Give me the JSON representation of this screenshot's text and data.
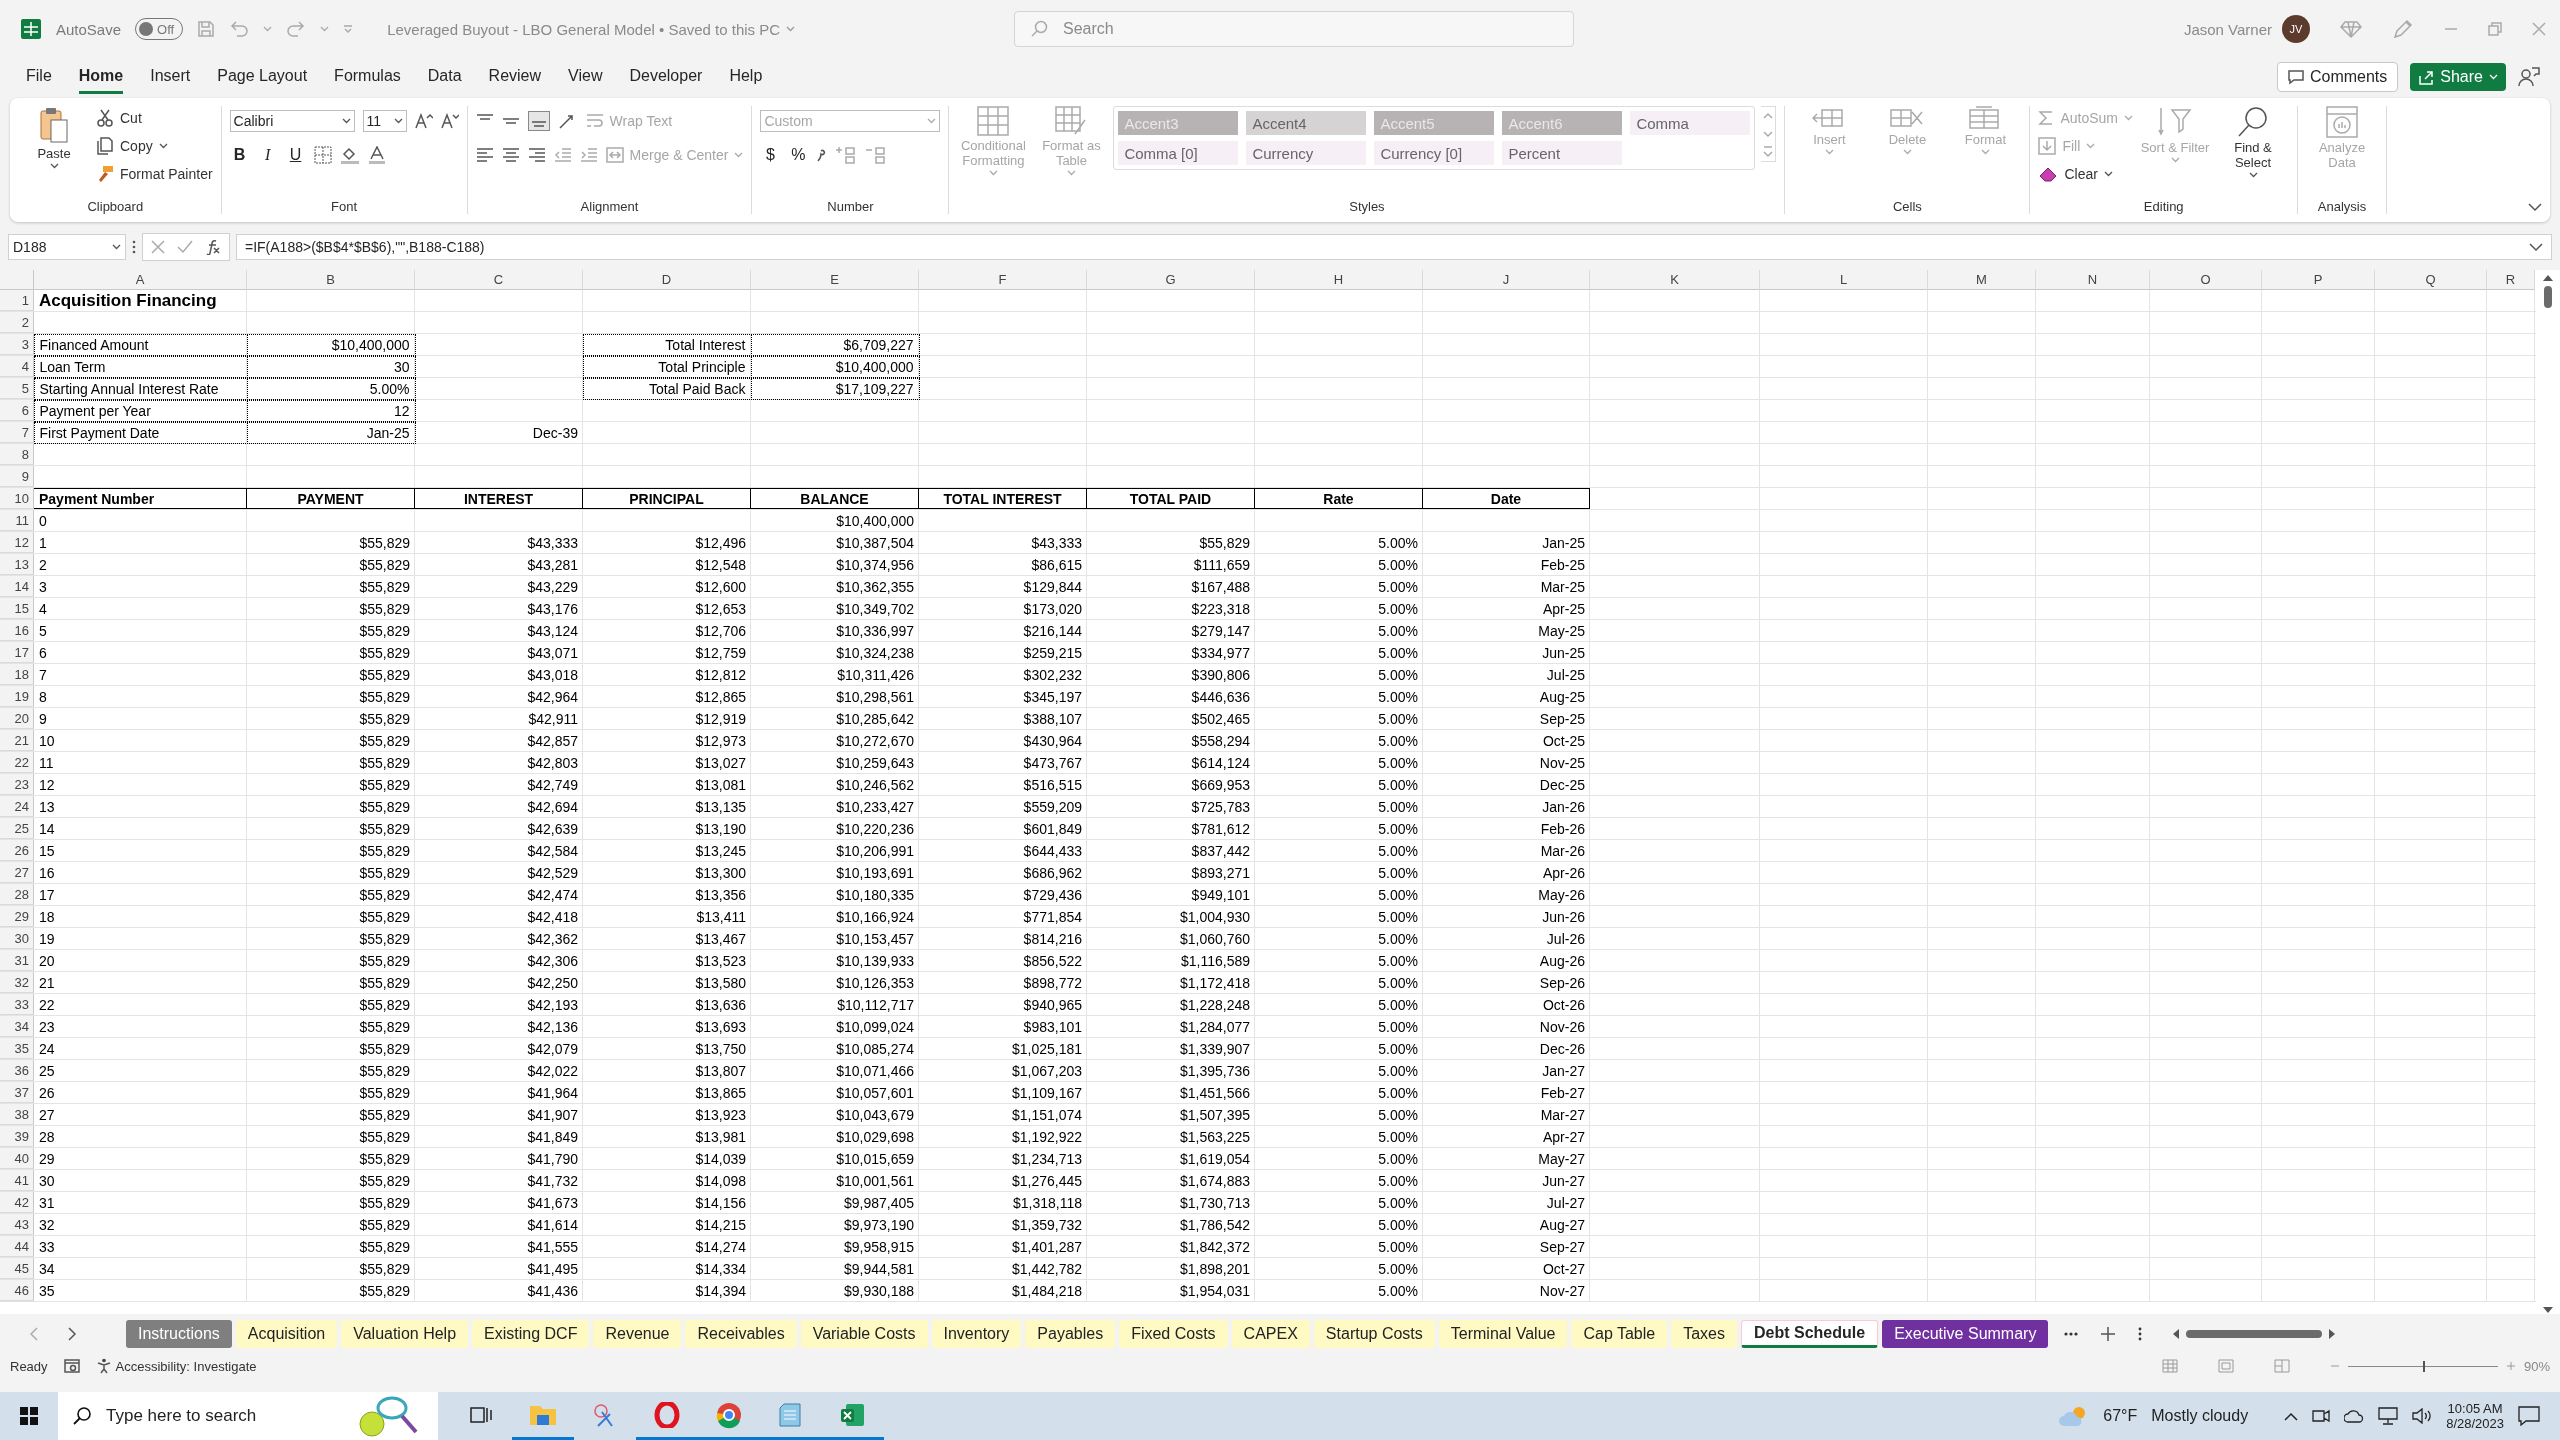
{
  "window": {
    "autosave_label": "AutoSave",
    "autosave": {
      "on": false,
      "label": "Off"
    },
    "title": "Leveraged Buyout - LBO General Model • Saved to this PC",
    "search": {
      "placeholder": "Search"
    },
    "user": {
      "name": "Jason Varner",
      "initials": "JV"
    }
  },
  "menu": [
    {
      "label": "File",
      "selected": false
    },
    {
      "label": "Home",
      "selected": true
    },
    {
      "label": "Insert",
      "selected": false
    },
    {
      "label": "Page Layout",
      "selected": false
    },
    {
      "label": "Formulas",
      "selected": false
    },
    {
      "label": "Data",
      "selected": false
    },
    {
      "label": "Review",
      "selected": false
    },
    {
      "label": "View",
      "selected": false
    },
    {
      "label": "Developer",
      "selected": false
    },
    {
      "label": "Help",
      "selected": false
    }
  ],
  "actions": {
    "comments": "Comments",
    "share": "Share"
  },
  "ribbon": {
    "groups": [
      {
        "kind": "clipboard",
        "label": "Clipboard",
        "items": [
          {
            "label": "Paste",
            "disabled": false
          },
          {
            "label": "Cut",
            "disabled": false
          },
          {
            "label": "Copy",
            "disabled": false
          },
          {
            "label": "Format Painter",
            "disabled": false
          }
        ]
      },
      {
        "kind": "font",
        "label": "Font",
        "font": "Calibri",
        "size": "11",
        "items": [
          {
            "label": "B",
            "disabled": false
          },
          {
            "label": "I",
            "disabled": false
          },
          {
            "label": "U",
            "disabled": false
          }
        ]
      },
      {
        "kind": "alignment",
        "label": "Alignment",
        "items": [
          {
            "label": "Wrap Text",
            "disabled": true
          },
          {
            "label": "Merge & Center",
            "disabled": true
          }
        ]
      },
      {
        "kind": "number",
        "label": "Number",
        "format": "Custom",
        "items": [
          {
            "label": "$",
            "disabled": false
          },
          {
            "label": "%",
            "disabled": false
          }
        ]
      },
      {
        "kind": "styles",
        "label": "Styles",
        "items": [
          {
            "label": "Conditional Formatting",
            "disabled": true
          },
          {
            "label": "Format as Table",
            "disabled": true
          }
        ],
        "gallery": [
          {
            "label": "Accent3",
            "color": "#b7b3b5"
          },
          {
            "label": "Accent4",
            "color": "#d6d3d5"
          },
          {
            "label": "Accent5",
            "color": "#b7b3b5"
          },
          {
            "label": "Accent6",
            "color": "#b7b3b5"
          },
          {
            "label": "Comma",
            "color": "#f6eff6"
          },
          {
            "label": "Comma [0]",
            "color": "#f6eff6"
          },
          {
            "label": "Currency",
            "color": "#f6eff6"
          },
          {
            "label": "Currency [0]",
            "color": "#f6eff6"
          },
          {
            "label": "Percent",
            "color": "#f6eff6"
          }
        ]
      },
      {
        "kind": "cells",
        "label": "Cells",
        "items": [
          {
            "label": "Insert",
            "disabled": true
          },
          {
            "label": "Delete",
            "disabled": true
          },
          {
            "label": "Format",
            "disabled": true
          }
        ]
      },
      {
        "kind": "editing",
        "label": "Editing",
        "items": [
          {
            "label": "AutoSum",
            "disabled": true
          },
          {
            "label": "Fill",
            "disabled": true
          },
          {
            "label": "Clear",
            "disabled": false
          },
          {
            "label": "Sort & Filter",
            "disabled": true
          },
          {
            "label": "Find & Select",
            "disabled": false
          }
        ]
      },
      {
        "kind": "analysis",
        "label": "Analysis",
        "items": [
          {
            "label": "Analyze Data",
            "disabled": true
          }
        ]
      }
    ]
  },
  "formula_bar": {
    "name_box": "D188",
    "formula": "=IF(A188>($B$4*$B$6),\"\",B188-C188)"
  },
  "sheet": {
    "columns": [
      "A",
      "B",
      "C",
      "D",
      "E",
      "F",
      "G",
      "H",
      "J",
      "K",
      "L",
      "M",
      "N",
      "O",
      "P",
      "Q",
      "R"
    ],
    "row_numbers": [
      "1",
      "2",
      "3",
      "4",
      "5",
      "6",
      "7",
      "8",
      "9",
      "10",
      "11",
      "12",
      "13",
      "14",
      "15",
      "16",
      "17",
      "18",
      "19",
      "20",
      "21",
      "22",
      "23",
      "24",
      "25",
      "26",
      "27",
      "28",
      "29",
      "30",
      "31",
      "32",
      "33",
      "34",
      "35",
      "36",
      "37",
      "38",
      "39",
      "40",
      "41",
      "42",
      "43",
      "44",
      "45",
      "46"
    ],
    "title": "Acquisition Financing",
    "inputs": [
      {
        "label": "Financed Amount",
        "value": "$10,400,000"
      },
      {
        "label": "Loan Term",
        "value": "30"
      },
      {
        "label": "Starting Annual Interest Rate",
        "value": "5.00%"
      },
      {
        "label": "Payment per Year",
        "value": "12"
      },
      {
        "label": "First Payment Date",
        "value": "Jan-25"
      }
    ],
    "totals": [
      {
        "label": "Total Interest",
        "value": "$6,709,227"
      },
      {
        "label": "Total Principle",
        "value": "$10,400,000"
      },
      {
        "label": "Total Paid Back",
        "value": "$17,109,227"
      }
    ],
    "end_date": "Dec-39",
    "schedule": {
      "columns": [
        "Payment Number",
        "PAYMENT",
        "INTEREST",
        "PRINCIPAL",
        "BALANCE",
        "TOTAL INTEREST",
        "TOTAL PAID",
        "Rate",
        "Date"
      ],
      "opening": {
        "number": "0",
        "balance": "$10,400,000"
      },
      "rows": [
        [
          "1",
          "$55,829",
          "$43,333",
          "$12,496",
          "$10,387,504",
          "$43,333",
          "$55,829",
          "5.00%",
          "Jan-25"
        ],
        [
          "2",
          "$55,829",
          "$43,281",
          "$12,548",
          "$10,374,956",
          "$86,615",
          "$111,659",
          "5.00%",
          "Feb-25"
        ],
        [
          "3",
          "$55,829",
          "$43,229",
          "$12,600",
          "$10,362,355",
          "$129,844",
          "$167,488",
          "5.00%",
          "Mar-25"
        ],
        [
          "4",
          "$55,829",
          "$43,176",
          "$12,653",
          "$10,349,702",
          "$173,020",
          "$223,318",
          "5.00%",
          "Apr-25"
        ],
        [
          "5",
          "$55,829",
          "$43,124",
          "$12,706",
          "$10,336,997",
          "$216,144",
          "$279,147",
          "5.00%",
          "May-25"
        ],
        [
          "6",
          "$55,829",
          "$43,071",
          "$12,759",
          "$10,324,238",
          "$259,215",
          "$334,977",
          "5.00%",
          "Jun-25"
        ],
        [
          "7",
          "$55,829",
          "$43,018",
          "$12,812",
          "$10,311,426",
          "$302,232",
          "$390,806",
          "5.00%",
          "Jul-25"
        ],
        [
          "8",
          "$55,829",
          "$42,964",
          "$12,865",
          "$10,298,561",
          "$345,197",
          "$446,636",
          "5.00%",
          "Aug-25"
        ],
        [
          "9",
          "$55,829",
          "$42,911",
          "$12,919",
          "$10,285,642",
          "$388,107",
          "$502,465",
          "5.00%",
          "Sep-25"
        ],
        [
          "10",
          "$55,829",
          "$42,857",
          "$12,973",
          "$10,272,670",
          "$430,964",
          "$558,294",
          "5.00%",
          "Oct-25"
        ],
        [
          "11",
          "$55,829",
          "$42,803",
          "$13,027",
          "$10,259,643",
          "$473,767",
          "$614,124",
          "5.00%",
          "Nov-25"
        ],
        [
          "12",
          "$55,829",
          "$42,749",
          "$13,081",
          "$10,246,562",
          "$516,515",
          "$669,953",
          "5.00%",
          "Dec-25"
        ],
        [
          "13",
          "$55,829",
          "$42,694",
          "$13,135",
          "$10,233,427",
          "$559,209",
          "$725,783",
          "5.00%",
          "Jan-26"
        ],
        [
          "14",
          "$55,829",
          "$42,639",
          "$13,190",
          "$10,220,236",
          "$601,849",
          "$781,612",
          "5.00%",
          "Feb-26"
        ],
        [
          "15",
          "$55,829",
          "$42,584",
          "$13,245",
          "$10,206,991",
          "$644,433",
          "$837,442",
          "5.00%",
          "Mar-26"
        ],
        [
          "16",
          "$55,829",
          "$42,529",
          "$13,300",
          "$10,193,691",
          "$686,962",
          "$893,271",
          "5.00%",
          "Apr-26"
        ],
        [
          "17",
          "$55,829",
          "$42,474",
          "$13,356",
          "$10,180,335",
          "$729,436",
          "$949,101",
          "5.00%",
          "May-26"
        ],
        [
          "18",
          "$55,829",
          "$42,418",
          "$13,411",
          "$10,166,924",
          "$771,854",
          "$1,004,930",
          "5.00%",
          "Jun-26"
        ],
        [
          "19",
          "$55,829",
          "$42,362",
          "$13,467",
          "$10,153,457",
          "$814,216",
          "$1,060,760",
          "5.00%",
          "Jul-26"
        ],
        [
          "20",
          "$55,829",
          "$42,306",
          "$13,523",
          "$10,139,933",
          "$856,522",
          "$1,116,589",
          "5.00%",
          "Aug-26"
        ],
        [
          "21",
          "$55,829",
          "$42,250",
          "$13,580",
          "$10,126,353",
          "$898,772",
          "$1,172,418",
          "5.00%",
          "Sep-26"
        ],
        [
          "22",
          "$55,829",
          "$42,193",
          "$13,636",
          "$10,112,717",
          "$940,965",
          "$1,228,248",
          "5.00%",
          "Oct-26"
        ],
        [
          "23",
          "$55,829",
          "$42,136",
          "$13,693",
          "$10,099,024",
          "$983,101",
          "$1,284,077",
          "5.00%",
          "Nov-26"
        ],
        [
          "24",
          "$55,829",
          "$42,079",
          "$13,750",
          "$10,085,274",
          "$1,025,181",
          "$1,339,907",
          "5.00%",
          "Dec-26"
        ],
        [
          "25",
          "$55,829",
          "$42,022",
          "$13,807",
          "$10,071,466",
          "$1,067,203",
          "$1,395,736",
          "5.00%",
          "Jan-27"
        ],
        [
          "26",
          "$55,829",
          "$41,964",
          "$13,865",
          "$10,057,601",
          "$1,109,167",
          "$1,451,566",
          "5.00%",
          "Feb-27"
        ],
        [
          "27",
          "$55,829",
          "$41,907",
          "$13,923",
          "$10,043,679",
          "$1,151,074",
          "$1,507,395",
          "5.00%",
          "Mar-27"
        ],
        [
          "28",
          "$55,829",
          "$41,849",
          "$13,981",
          "$10,029,698",
          "$1,192,922",
          "$1,563,225",
          "5.00%",
          "Apr-27"
        ],
        [
          "29",
          "$55,829",
          "$41,790",
          "$14,039",
          "$10,015,659",
          "$1,234,713",
          "$1,619,054",
          "5.00%",
          "May-27"
        ],
        [
          "30",
          "$55,829",
          "$41,732",
          "$14,098",
          "$10,001,561",
          "$1,276,445",
          "$1,674,883",
          "5.00%",
          "Jun-27"
        ],
        [
          "31",
          "$55,829",
          "$41,673",
          "$14,156",
          "$9,987,405",
          "$1,318,118",
          "$1,730,713",
          "5.00%",
          "Jul-27"
        ],
        [
          "32",
          "$55,829",
          "$41,614",
          "$14,215",
          "$9,973,190",
          "$1,359,732",
          "$1,786,542",
          "5.00%",
          "Aug-27"
        ],
        [
          "33",
          "$55,829",
          "$41,555",
          "$14,274",
          "$9,958,915",
          "$1,401,287",
          "$1,842,372",
          "5.00%",
          "Sep-27"
        ],
        [
          "34",
          "$55,829",
          "$41,495",
          "$14,334",
          "$9,944,581",
          "$1,442,782",
          "$1,898,201",
          "5.00%",
          "Oct-27"
        ],
        [
          "35",
          "$55,829",
          "$41,436",
          "$14,394",
          "$9,930,188",
          "$1,484,218",
          "$1,954,031",
          "5.00%",
          "Nov-27"
        ]
      ]
    }
  },
  "sheet_tabs": [
    {
      "label": "Instructions",
      "selected": false,
      "color": "#7f7f7f"
    },
    {
      "label": "Acquisition",
      "selected": false,
      "color": "#fff9c4"
    },
    {
      "label": "Valuation Help",
      "selected": false,
      "color": "#fff9c4"
    },
    {
      "label": "Existing DCF",
      "selected": false,
      "color": "#fff9c4"
    },
    {
      "label": "Revenue",
      "selected": false,
      "color": "#fff9c4"
    },
    {
      "label": "Receivables",
      "selected": false,
      "color": "#fff9c4"
    },
    {
      "label": "Variable Costs",
      "selected": false,
      "color": "#fff9c4"
    },
    {
      "label": "Inventory",
      "selected": false,
      "color": "#fff9c4"
    },
    {
      "label": "Payables",
      "selected": false,
      "color": "#fff9c4"
    },
    {
      "label": "Fixed Costs",
      "selected": false,
      "color": "#fff9c4"
    },
    {
      "label": "CAPEX",
      "selected": false,
      "color": "#fff9c4"
    },
    {
      "label": "Startup Costs",
      "selected": false,
      "color": "#fff9c4"
    },
    {
      "label": "Terminal Value",
      "selected": false,
      "color": "#fff9c4"
    },
    {
      "label": "Cap Table",
      "selected": false,
      "color": "#fff9c4"
    },
    {
      "label": "Taxes",
      "selected": false,
      "color": "#fff9c4"
    },
    {
      "label": "Debt Schedule",
      "selected": true,
      "color": "#ffc7ce"
    },
    {
      "label": "Executive Summary",
      "selected": false,
      "color": "#7030a0"
    }
  ],
  "status_bar": {
    "mode": "Ready",
    "accessibility": "Accessibility: Investigate",
    "zoom": {
      "level": 0.5,
      "label": "90%"
    }
  },
  "taskbar": {
    "search": {
      "placeholder": "Type here to search"
    },
    "weather": {
      "temperature": "67°F",
      "condition": "Mostly cloudy"
    },
    "time": "10:05 AM",
    "date": "8/28/2023"
  }
}
